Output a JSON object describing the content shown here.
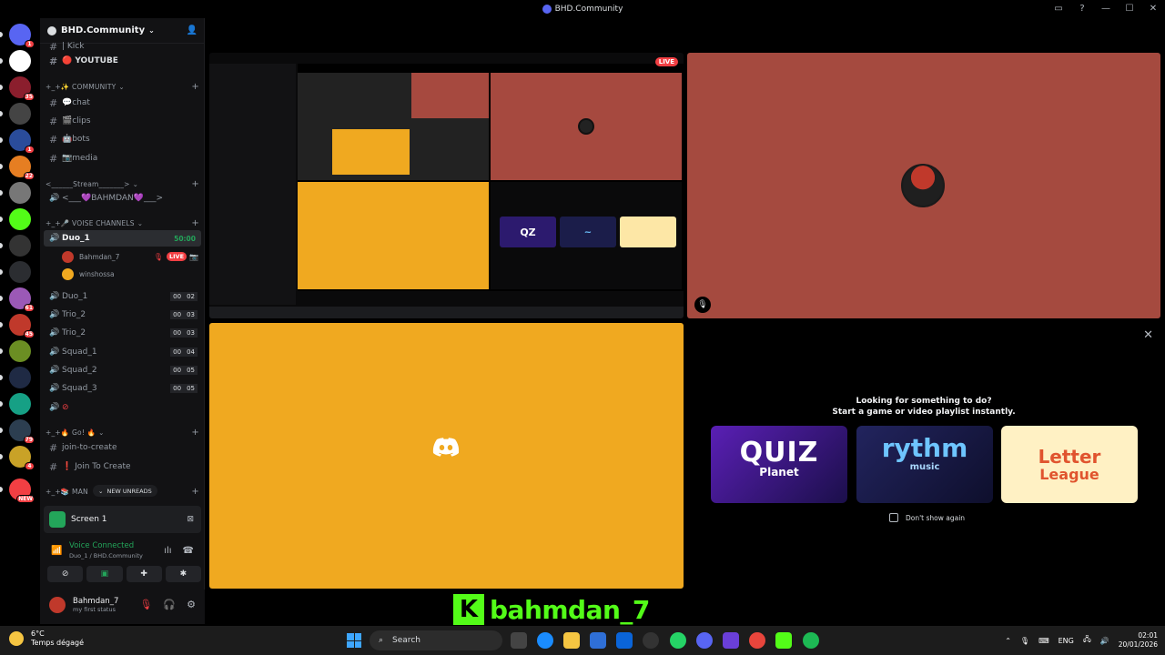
{
  "window": {
    "title": "BHD.Community"
  },
  "guilds": [
    {
      "name": "discord-home",
      "badge": "1",
      "color": "#5865f2"
    },
    {
      "name": "guild-2",
      "badge": "",
      "color": "#ffffff"
    },
    {
      "name": "guild-3",
      "badge": "35",
      "color": "#8b1e2d"
    },
    {
      "name": "guild-4",
      "badge": "",
      "color": "#444444"
    },
    {
      "name": "guild-5",
      "badge": "1",
      "color": "#2a4c9b"
    },
    {
      "name": "guild-6",
      "badge": "22",
      "color": "#e67e22"
    },
    {
      "name": "guild-7",
      "badge": "",
      "color": "#777777"
    },
    {
      "name": "guild-kick",
      "badge": "",
      "color": "#53fc18"
    },
    {
      "name": "guild-9",
      "badge": "",
      "color": "#333333"
    },
    {
      "name": "guild-bhd",
      "badge": "",
      "color": "#2b2d31"
    },
    {
      "name": "guild-11",
      "badge": "61",
      "color": "#9b59b6"
    },
    {
      "name": "guild-12",
      "badge": "45",
      "color": "#c0392b"
    },
    {
      "name": "guild-13",
      "badge": "",
      "color": "#6b8e23"
    },
    {
      "name": "guild-14",
      "badge": "",
      "color": "#1f2a44"
    },
    {
      "name": "guild-15",
      "badge": "",
      "color": "#16a085"
    },
    {
      "name": "guild-16",
      "badge": "79",
      "color": "#2c3e50"
    },
    {
      "name": "guild-17",
      "badge": "4",
      "color": "#c9a227"
    },
    {
      "name": "guild-new",
      "badge": "NEW",
      "color": "#f23f43"
    }
  ],
  "server": {
    "name": "BHD.Community",
    "top_channels": [
      {
        "label": "| Kick"
      },
      {
        "label": "🔴 YOUTUBE"
      }
    ],
    "categories": {
      "community": "+_+✨ COMMUNITY",
      "stream": "<______Stream_______>",
      "voice": "+_+🎤 VOISE CHANNELS",
      "go": "+_+🔥 Go! 🔥",
      "manage": "+_+📚 MAN"
    },
    "community_channels": [
      {
        "label": "💬chat"
      },
      {
        "label": "🎬clips"
      },
      {
        "label": "🤖bots"
      },
      {
        "label": "📷media"
      }
    ],
    "stream_channel": "<___💜BAHMDAN💜___>",
    "active_voice": {
      "label": "Duo_1",
      "timer": "50:00"
    },
    "voice_users": [
      {
        "name": "Bahmdan_7",
        "live": "LIVE"
      },
      {
        "name": "winshossa",
        "live": ""
      }
    ],
    "voice_channels": [
      {
        "label": "Duo_1",
        "count_a": "00",
        "count_b": "02"
      },
      {
        "label": "Trio_2",
        "count_a": "00",
        "count_b": "03"
      },
      {
        "label": "Trio_2",
        "count_a": "00",
        "count_b": "03"
      },
      {
        "label": "Squad_1",
        "count_a": "00",
        "count_b": "04"
      },
      {
        "label": "Squad_2",
        "count_a": "00",
        "count_b": "05"
      },
      {
        "label": "Squad_3",
        "count_a": "00",
        "count_b": "05"
      }
    ],
    "go_channels": [
      {
        "label": "join-to-create"
      },
      {
        "label": "❗ Join To Create"
      }
    ],
    "new_unreads": "NEW UNREADS"
  },
  "screen_panel": {
    "label": "Screen 1"
  },
  "voice_panel": {
    "status": "Voice Connected",
    "sub": "Duo_1 / BHD.Community"
  },
  "user": {
    "name": "Bahmdan_7",
    "status": "my first status"
  },
  "stage": {
    "live_badge": "LIVE",
    "activity_title_1": "Looking for something to do?",
    "activity_title_2": "Start a game or video playlist instantly.",
    "cards": [
      {
        "name": "QUIZ",
        "sub": "Planet"
      },
      {
        "name": "rythm",
        "sub": "music"
      },
      {
        "name": "Letter",
        "sub": "League"
      }
    ],
    "dont_show": "Don't show again"
  },
  "overlay": {
    "kick_letter": "K",
    "kick_name": "bahmdan_7"
  },
  "taskbar": {
    "temp": "6°C",
    "weather": "Temps dégagé",
    "search": "Search",
    "lang": "ENG",
    "time": "02:01",
    "date": "20/01/2026"
  },
  "colors": {
    "accent": "#5865f2",
    "green": "#23a55a",
    "red": "#f23f43",
    "cam_bg": "#a54a3f",
    "yellow_tile": "#f0a920",
    "kick_green": "#53fc18"
  }
}
